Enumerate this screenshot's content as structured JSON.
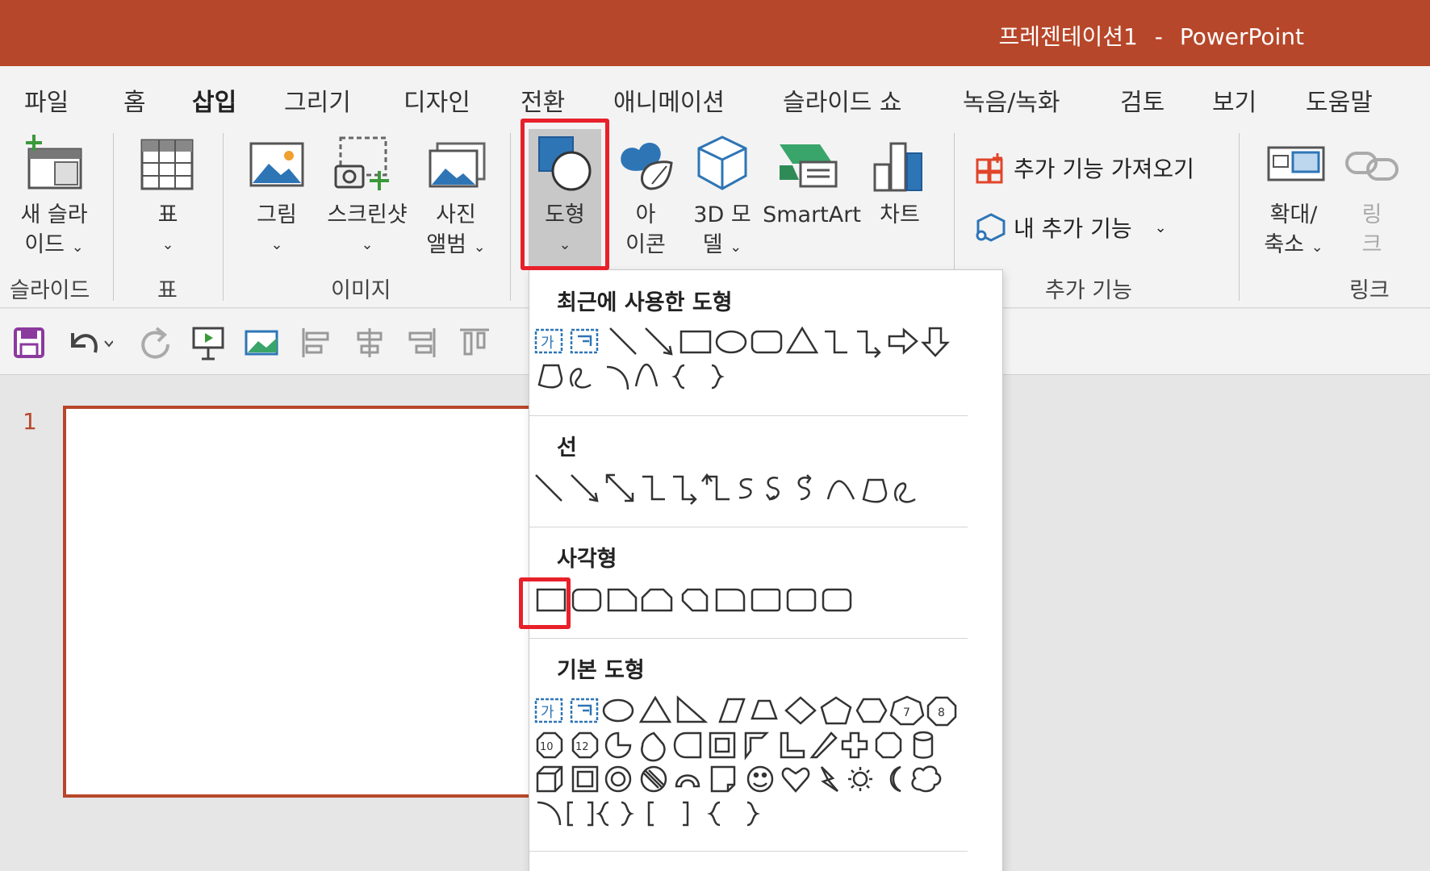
{
  "window": {
    "doc_title": "프레젠테이션1",
    "separator": "-",
    "app_name": "PowerPoint"
  },
  "tabs": [
    {
      "label": "파일"
    },
    {
      "label": "홈"
    },
    {
      "label": "삽입"
    },
    {
      "label": "그리기"
    },
    {
      "label": "디자인"
    },
    {
      "label": "전환"
    },
    {
      "label": "애니메이션"
    },
    {
      "label": "슬라이드 쇼"
    },
    {
      "label": "녹음/녹화"
    },
    {
      "label": "검토"
    },
    {
      "label": "보기"
    },
    {
      "label": "도움말"
    }
  ],
  "ribbon": {
    "new_slide": {
      "line1": "새 슬라",
      "line2": "이드"
    },
    "table": {
      "label": "표"
    },
    "picture": {
      "label": "그림"
    },
    "screenshot": {
      "label": "스크린샷"
    },
    "album": {
      "line1": "사진",
      "line2": "앨범"
    },
    "shapes": {
      "label": "도형"
    },
    "icons": {
      "line1": "아",
      "line2": "이콘"
    },
    "model3d": {
      "line1": "3D 모",
      "line2": "델"
    },
    "smartart": {
      "label": "SmartArt"
    },
    "chart": {
      "label": "차트"
    },
    "get_addins": {
      "label": "추가 기능 가져오기"
    },
    "my_addins": {
      "label": "내 추가 기능"
    },
    "zoom": {
      "line1": "확대/",
      "line2": "축소"
    },
    "link": {
      "line1": "링",
      "line2": "크"
    },
    "groups": {
      "slides": "슬라이드",
      "table": "표",
      "images": "이미지",
      "addins": "추가 기능",
      "links": "링크"
    }
  },
  "slide_panel": {
    "number": "1"
  },
  "shapes_menu": {
    "recent": {
      "title": "최근에 사용한 도형"
    },
    "lines": {
      "title": "선"
    },
    "rectangles": {
      "title": "사각형"
    },
    "basic": {
      "title": "기본 도형",
      "num7": "7",
      "num8": "8",
      "num10": "10",
      "num12": "12"
    },
    "textbox_glyph": "가"
  },
  "colors": {
    "accent": "#b7472a",
    "highlight": "#e8202a",
    "icon_blue": "#2e75b6"
  }
}
